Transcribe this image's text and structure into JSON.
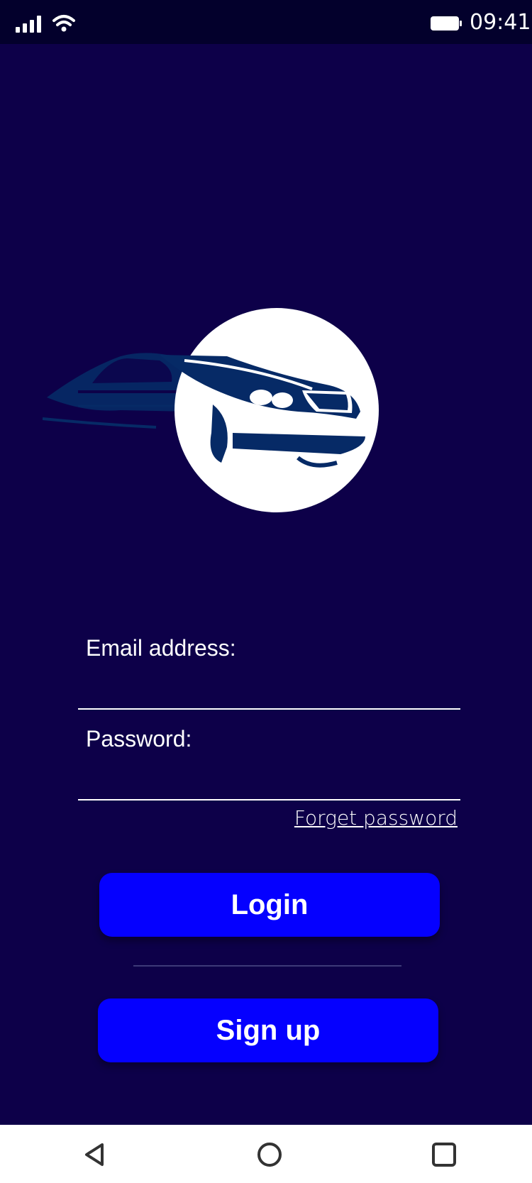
{
  "status_bar": {
    "time": "09:41",
    "icons": [
      "signal-icon",
      "wifi-icon",
      "battery-icon"
    ]
  },
  "logo": {
    "icon": "car-logo-icon"
  },
  "form": {
    "email_label": "Email address:",
    "email_value": "",
    "password_label": "Password:",
    "password_value": "",
    "forget_password": "Forget password"
  },
  "buttons": {
    "login": "Login",
    "signup": "Sign up"
  },
  "nav": {
    "icons": [
      "back-icon",
      "home-icon",
      "recent-apps-icon"
    ]
  },
  "colors": {
    "background": "#0d0049",
    "status_bar": "#03002c",
    "button": "#0500ff",
    "logo_car": "#062a66"
  }
}
